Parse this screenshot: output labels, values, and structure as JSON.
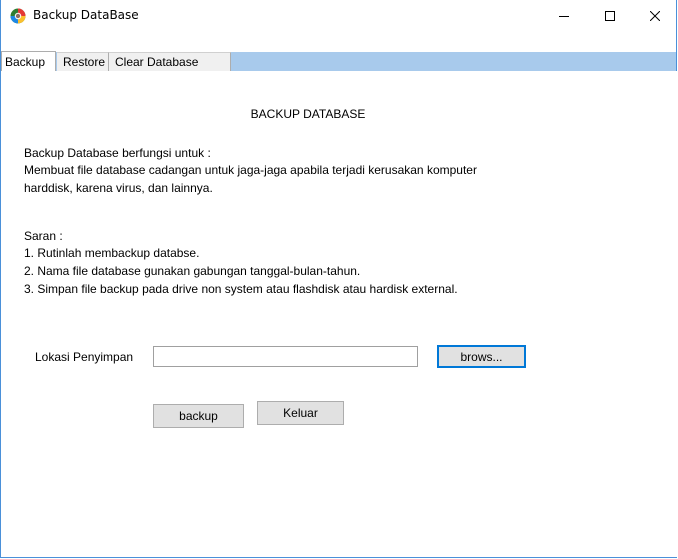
{
  "window": {
    "title": "Backup DataBase",
    "colors": {
      "border": "#4a90d9",
      "tabbar": "#a8caec",
      "focus": "#0078d7"
    }
  },
  "tabs": [
    {
      "label": "Backup",
      "active": true
    },
    {
      "label": "Restore",
      "active": false
    },
    {
      "label": "Clear Database",
      "active": false
    }
  ],
  "panel": {
    "heading": "BACKUP DATABASE",
    "description": [
      "Backup Database berfungsi untuk :",
      "Membuat file database cadangan untuk jaga-jaga apabila terjadi kerusakan komputer",
      "harddisk, karena virus, dan lainnya."
    ],
    "saran_title": "Saran :",
    "saran": [
      "1. Rutinlah membackup databse.",
      "2. Nama file database gunakan gabungan tanggal-bulan-tahun.",
      "3. Simpan file backup pada drive non system atau flashdisk atau hardisk external."
    ],
    "location_label": "Lokasi Penyimpan",
    "location_value": "",
    "browse_label": "brows...",
    "backup_label": "backup",
    "exit_label": "Keluar"
  }
}
